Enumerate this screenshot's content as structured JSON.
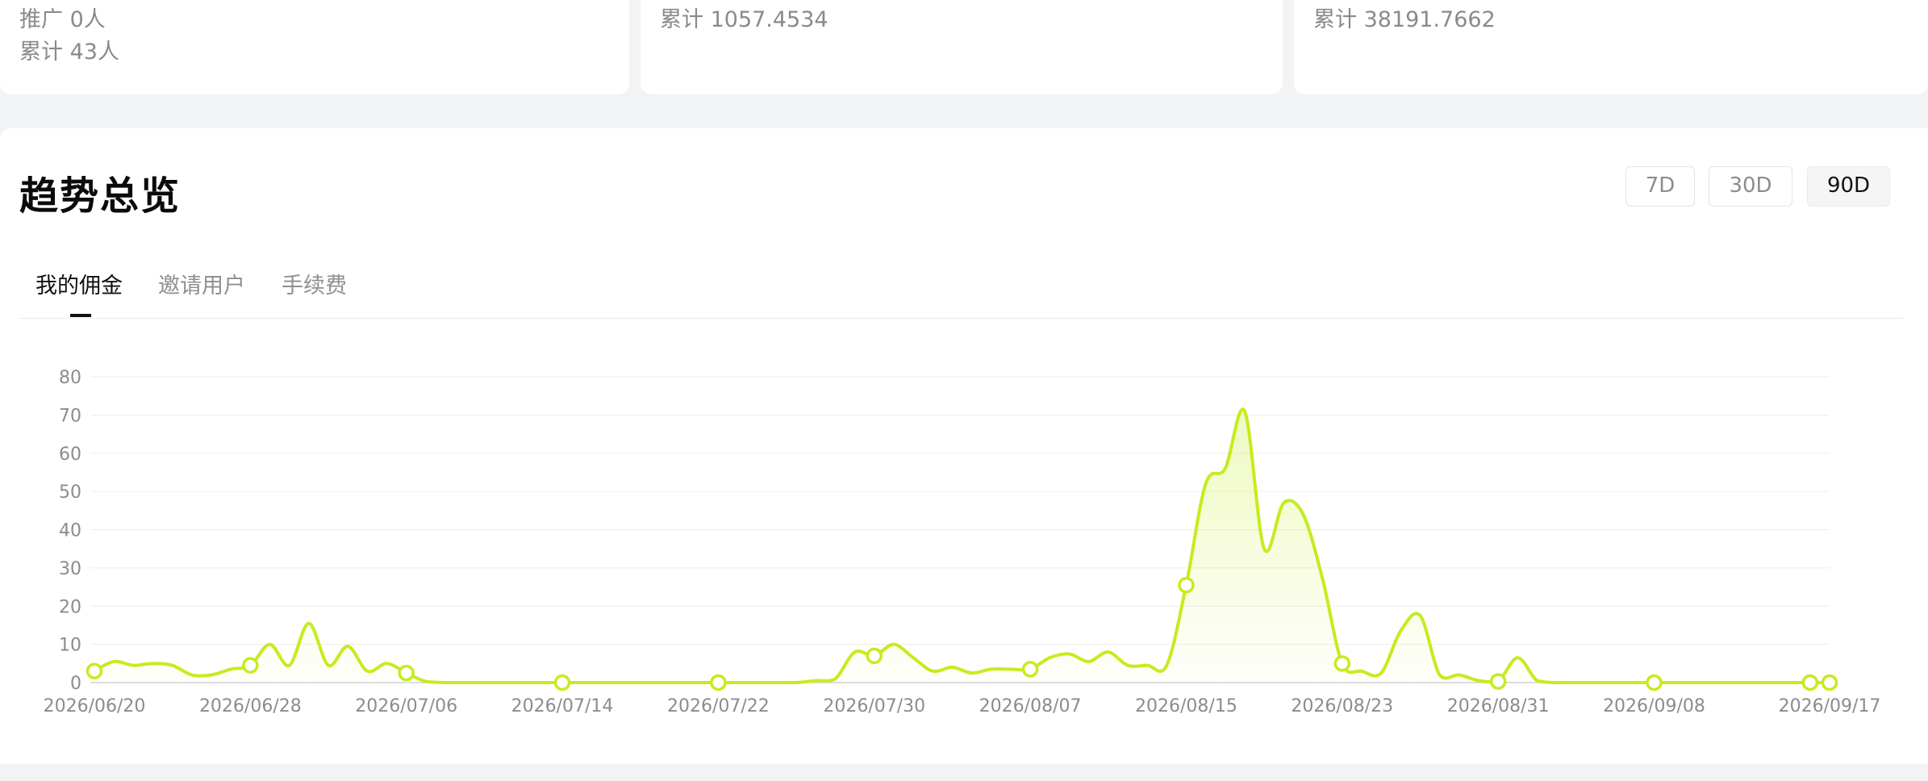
{
  "cards": [
    {
      "lines": [
        "推广 0人",
        "累计 43人"
      ]
    },
    {
      "lines": [
        "累计 1057.4534"
      ]
    },
    {
      "lines": [
        "累计 38191.7662"
      ]
    }
  ],
  "trend": {
    "title": "趋势总览",
    "ranges": [
      "7D",
      "30D",
      "90D"
    ],
    "active_range": "90D",
    "tabs": [
      "我的佣金",
      "邀请用户",
      "手续费"
    ],
    "active_tab": "我的佣金",
    "colors": {
      "line": "#c5ec1e",
      "marker_fill": "#ffffff"
    }
  },
  "chart_data": {
    "type": "area",
    "title": "",
    "xlabel": "",
    "ylabel": "",
    "ylim": [
      0,
      80
    ],
    "yticks": [
      0,
      10,
      20,
      30,
      40,
      50,
      60,
      70,
      80
    ],
    "x_tick_labels": [
      "2026/06/20",
      "2026/06/28",
      "2026/07/06",
      "2026/07/14",
      "2026/07/22",
      "2026/07/30",
      "2026/08/07",
      "2026/08/15",
      "2026/08/23",
      "2026/08/31",
      "2026/09/08",
      "2026/09/17"
    ],
    "grid": true,
    "x": [
      "2026/06/20",
      "2026/06/21",
      "2026/06/22",
      "2026/06/23",
      "2026/06/24",
      "2026/06/25",
      "2026/06/26",
      "2026/06/27",
      "2026/06/28",
      "2026/06/29",
      "2026/06/30",
      "2026/07/01",
      "2026/07/02",
      "2026/07/03",
      "2026/07/04",
      "2026/07/05",
      "2026/07/06",
      "2026/07/07",
      "2026/07/08",
      "2026/07/09",
      "2026/07/10",
      "2026/07/11",
      "2026/07/12",
      "2026/07/13",
      "2026/07/14",
      "2026/07/15",
      "2026/07/16",
      "2026/07/17",
      "2026/07/18",
      "2026/07/19",
      "2026/07/20",
      "2026/07/21",
      "2026/07/22",
      "2026/07/23",
      "2026/07/24",
      "2026/07/25",
      "2026/07/26",
      "2026/07/27",
      "2026/07/28",
      "2026/07/29",
      "2026/07/30",
      "2026/07/31",
      "2026/08/01",
      "2026/08/02",
      "2026/08/03",
      "2026/08/04",
      "2026/08/05",
      "2026/08/06",
      "2026/08/07",
      "2026/08/08",
      "2026/08/09",
      "2026/08/10",
      "2026/08/11",
      "2026/08/12",
      "2026/08/13",
      "2026/08/14",
      "2026/08/15",
      "2026/08/16",
      "2026/08/17",
      "2026/08/18",
      "2026/08/19",
      "2026/08/20",
      "2026/08/21",
      "2026/08/22",
      "2026/08/23",
      "2026/08/24",
      "2026/08/25",
      "2026/08/26",
      "2026/08/27",
      "2026/08/28",
      "2026/08/29",
      "2026/08/30",
      "2026/08/31",
      "2026/09/01",
      "2026/09/02",
      "2026/09/03",
      "2026/09/04",
      "2026/09/05",
      "2026/09/06",
      "2026/09/07",
      "2026/09/08",
      "2026/09/09",
      "2026/09/10",
      "2026/09/11",
      "2026/09/12",
      "2026/09/13",
      "2026/09/14",
      "2026/09/15",
      "2026/09/16",
      "2026/09/17"
    ],
    "series": [
      {
        "values": [
          3,
          5.5,
          4.5,
          5,
          4.5,
          2,
          2,
          3.5,
          4.5,
          10,
          4.5,
          15.5,
          4.5,
          9.5,
          3,
          5,
          2.5,
          0.3,
          0,
          0,
          0,
          0,
          0,
          0,
          0,
          0,
          0,
          0,
          0,
          0,
          0,
          0,
          0,
          0,
          0,
          0,
          0,
          0.5,
          1,
          8,
          7,
          10,
          6.5,
          3,
          4,
          2.5,
          3.5,
          3.5,
          3.5,
          6.5,
          7.5,
          5.5,
          8,
          4.5,
          4.5,
          4.5,
          25.5,
          52,
          56,
          71,
          35,
          47,
          44,
          27,
          5,
          3,
          2.5,
          13.5,
          17.5,
          2,
          2,
          0.5,
          0.3,
          6.5,
          0.5,
          0,
          0,
          0,
          0,
          0,
          0,
          0,
          0,
          0,
          0,
          0,
          0,
          0,
          0,
          0
        ]
      }
    ],
    "markers_at": [
      "2026/06/20",
      "2026/06/28",
      "2026/07/06",
      "2026/07/14",
      "2026/07/22",
      "2026/07/30",
      "2026/08/07",
      "2026/08/15",
      "2026/08/23",
      "2026/08/31",
      "2026/09/08",
      "2026/09/16",
      "2026/09/17"
    ]
  }
}
